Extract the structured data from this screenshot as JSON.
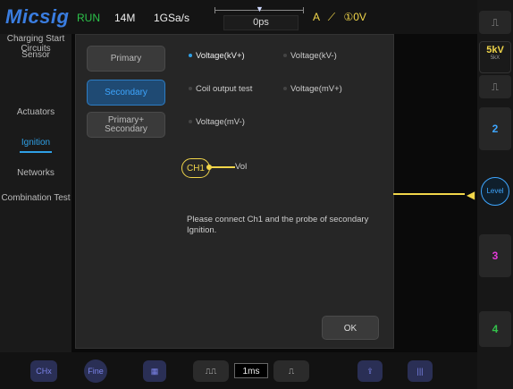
{
  "header": {
    "logo": "Micsig",
    "run_status": "RUN",
    "memory_depth": "14M",
    "sample_rate": "1GSa/s",
    "time_offset": "0ps",
    "trigger_label": "A",
    "trigger_value": "①0V"
  },
  "left_menu": {
    "items": [
      {
        "label": "Charging Start Circuits"
      },
      {
        "label": "Sensor"
      },
      {
        "label": "Actuators"
      },
      {
        "label": "Ignition"
      },
      {
        "label": "Networks"
      },
      {
        "label": "Combination Test"
      }
    ],
    "active": "Ignition"
  },
  "dialog": {
    "mode_buttons": [
      {
        "label": "Primary"
      },
      {
        "label": "Secondary"
      },
      {
        "label": "Primary+ Secondary"
      }
    ],
    "selected_mode": "Secondary",
    "options": [
      {
        "label": "Voltage(kV+)"
      },
      {
        "label": "Voltage(kV-)"
      },
      {
        "label": "Coil output test"
      },
      {
        "label": "Voltage(mV+)"
      },
      {
        "label": "Voltage(mV-)"
      }
    ],
    "selected_option": "Voltage(kV+)",
    "channel_badge": "CH1",
    "probe_label": "Vol",
    "message": "Please connect Ch1 and the probe of secondary Ignition.",
    "ok_label": "OK"
  },
  "right_bar": {
    "scale": "5kV",
    "scale_sub": "5kX",
    "channels": [
      "2",
      "3",
      "4"
    ],
    "level_label": "Level"
  },
  "bottom_bar": {
    "chx_label": "CHx",
    "fine_label": "Fine",
    "time_scale": "1ms"
  },
  "colors": {
    "ch1": "#f1d64a",
    "ch2": "#3ea6ff",
    "ch3": "#e23ad8",
    "ch4": "#33c24b",
    "accent": "#2fa0e6"
  }
}
